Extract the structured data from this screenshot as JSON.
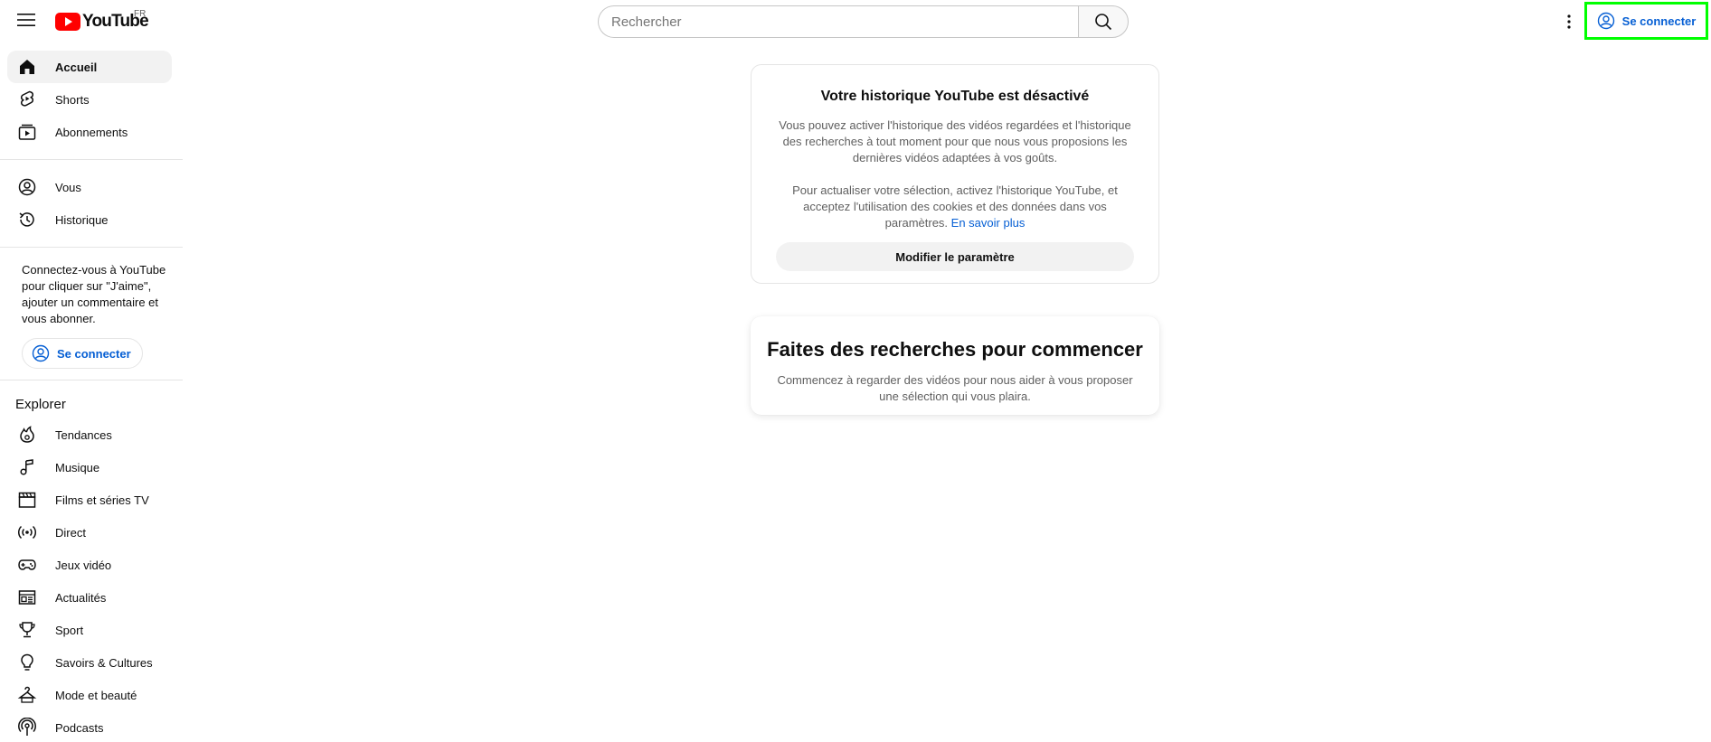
{
  "header": {
    "logo_text": "YouTube",
    "country_code": "FR",
    "search_placeholder": "Rechercher",
    "signin_label": "Se connecter"
  },
  "sidebar": {
    "main_items": [
      {
        "label": "Accueil",
        "icon": "home-icon",
        "active": true
      },
      {
        "label": "Shorts",
        "icon": "shorts-icon"
      },
      {
        "label": "Abonnements",
        "icon": "subscriptions-icon"
      }
    ],
    "you_items": [
      {
        "label": "Vous",
        "icon": "user-circle-icon"
      },
      {
        "label": "Historique",
        "icon": "history-icon"
      }
    ],
    "signin_prompt": "Connectez-vous à YouTube pour cliquer sur \"J'aime\", ajouter un commentaire et vous abonner.",
    "signin_label": "Se connecter",
    "explore_title": "Explorer",
    "explore_items": [
      {
        "label": "Tendances",
        "icon": "trending-icon"
      },
      {
        "label": "Musique",
        "icon": "music-note-icon"
      },
      {
        "label": "Films et séries TV",
        "icon": "clapperboard-icon"
      },
      {
        "label": "Direct",
        "icon": "live-icon"
      },
      {
        "label": "Jeux vidéo",
        "icon": "gamepad-icon"
      },
      {
        "label": "Actualités",
        "icon": "newspaper-icon"
      },
      {
        "label": "Sport",
        "icon": "trophy-icon"
      },
      {
        "label": "Savoirs & Cultures",
        "icon": "lightbulb-icon"
      },
      {
        "label": "Mode et beauté",
        "icon": "hanger-icon"
      },
      {
        "label": "Podcasts",
        "icon": "podcast-icon"
      }
    ]
  },
  "history_card": {
    "title": "Votre historique YouTube est désactivé",
    "paragraph1": "Vous pouvez activer l'historique des vidéos regardées et l'historique des recherches à tout moment pour que nous vous proposions les dernières vidéos adaptées à vos goûts.",
    "paragraph2": "Pour actualiser votre sélection, activez l'historique YouTube, et acceptez l'utilisation des cookies et des données dans vos paramètres.",
    "learn_more": "En savoir plus",
    "button_label": "Modifier le paramètre"
  },
  "search_card": {
    "title": "Faites des recherches pour commencer",
    "text": "Commencez à regarder des vidéos pour nous aider à vous proposer une sélection qui vous plaira."
  },
  "colors": {
    "brand_red": "#ff0000",
    "link_blue": "#065fd4",
    "highlight_green": "#00ff00"
  }
}
